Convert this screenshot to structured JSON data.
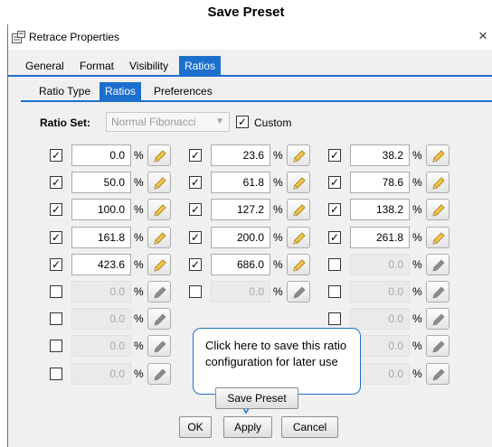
{
  "caption": "Save Preset",
  "window": {
    "title": "Retrace Properties",
    "close_glyph": "×"
  },
  "main_tabs": [
    {
      "label": "General",
      "active": false
    },
    {
      "label": "Format",
      "active": false
    },
    {
      "label": "Visibility",
      "active": false
    },
    {
      "label": "Ratios",
      "active": true
    }
  ],
  "sub_tabs": [
    {
      "label": "Ratio Type",
      "active": false
    },
    {
      "label": "Ratios",
      "active": true
    },
    {
      "label": "Preferences",
      "active": false
    }
  ],
  "ratio_set": {
    "label": "Ratio Set:",
    "value": "Normal Fibonacci",
    "enabled": false
  },
  "custom": {
    "label": "Custom",
    "checked": true
  },
  "percent_sign": "%",
  "ratios": [
    [
      {
        "checked": true,
        "value": "0.0",
        "enabled": true
      },
      {
        "checked": true,
        "value": "23.6",
        "enabled": true
      },
      {
        "checked": true,
        "value": "38.2",
        "enabled": true
      }
    ],
    [
      {
        "checked": true,
        "value": "50.0",
        "enabled": true
      },
      {
        "checked": true,
        "value": "61.8",
        "enabled": true
      },
      {
        "checked": true,
        "value": "78.6",
        "enabled": true
      }
    ],
    [
      {
        "checked": true,
        "value": "100.0",
        "enabled": true
      },
      {
        "checked": true,
        "value": "127.2",
        "enabled": true
      },
      {
        "checked": true,
        "value": "138.2",
        "enabled": true
      }
    ],
    [
      {
        "checked": true,
        "value": "161.8",
        "enabled": true
      },
      {
        "checked": true,
        "value": "200.0",
        "enabled": true
      },
      {
        "checked": true,
        "value": "261.8",
        "enabled": true
      }
    ],
    [
      {
        "checked": true,
        "value": "423.6",
        "enabled": true
      },
      {
        "checked": true,
        "value": "686.0",
        "enabled": true
      },
      {
        "checked": false,
        "value": "0.0",
        "enabled": false
      }
    ],
    [
      {
        "checked": false,
        "value": "0.0",
        "enabled": false
      },
      {
        "checked": false,
        "value": "0.0",
        "enabled": false
      },
      {
        "checked": false,
        "value": "0.0",
        "enabled": false
      }
    ],
    [
      {
        "checked": false,
        "value": "0.0",
        "enabled": false
      },
      null,
      {
        "checked": false,
        "value": "0.0",
        "enabled": false
      }
    ],
    [
      {
        "checked": false,
        "value": "0.0",
        "enabled": false
      },
      null,
      {
        "checked": false,
        "value": "0.0",
        "enabled": false
      }
    ],
    [
      {
        "checked": false,
        "value": "0.0",
        "enabled": false
      },
      null,
      {
        "checked": false,
        "value": "0.0",
        "enabled": false
      }
    ]
  ],
  "callout": {
    "text": "Click here to save this ratio configuration for later use"
  },
  "buttons": {
    "save_preset": "Save Preset",
    "ok": "OK",
    "apply": "Apply",
    "cancel": "Cancel"
  },
  "colors": {
    "accent": "#1c6fcd"
  }
}
